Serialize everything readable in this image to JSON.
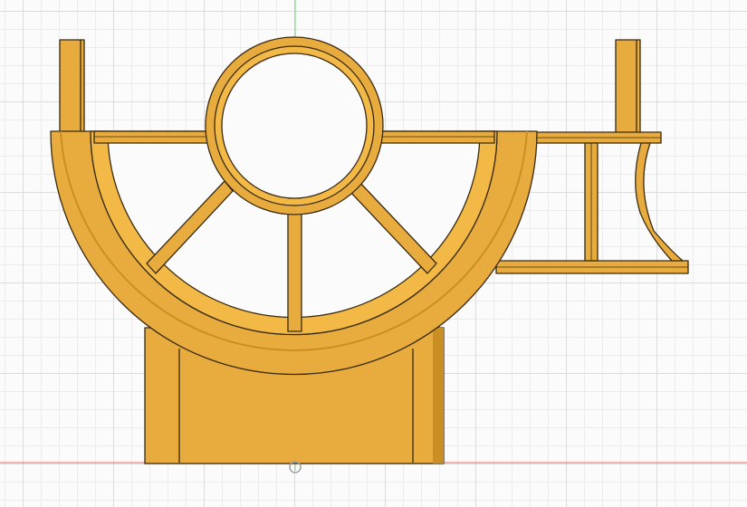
{
  "viewport": {
    "background": "#fbfbfb",
    "grid_minor_color": "#ececec",
    "grid_major_color": "#dcdcdc",
    "axis_x_color": "#e46a6a",
    "axis_y_color": "#7bd07b"
  },
  "model": {
    "body_color": "#e8ac3e",
    "face_color": "#f2b947",
    "shadow_color": "#c98e24",
    "edge_color": "#3a2a10"
  },
  "icons": {
    "origin": "origin-marker-icon"
  }
}
